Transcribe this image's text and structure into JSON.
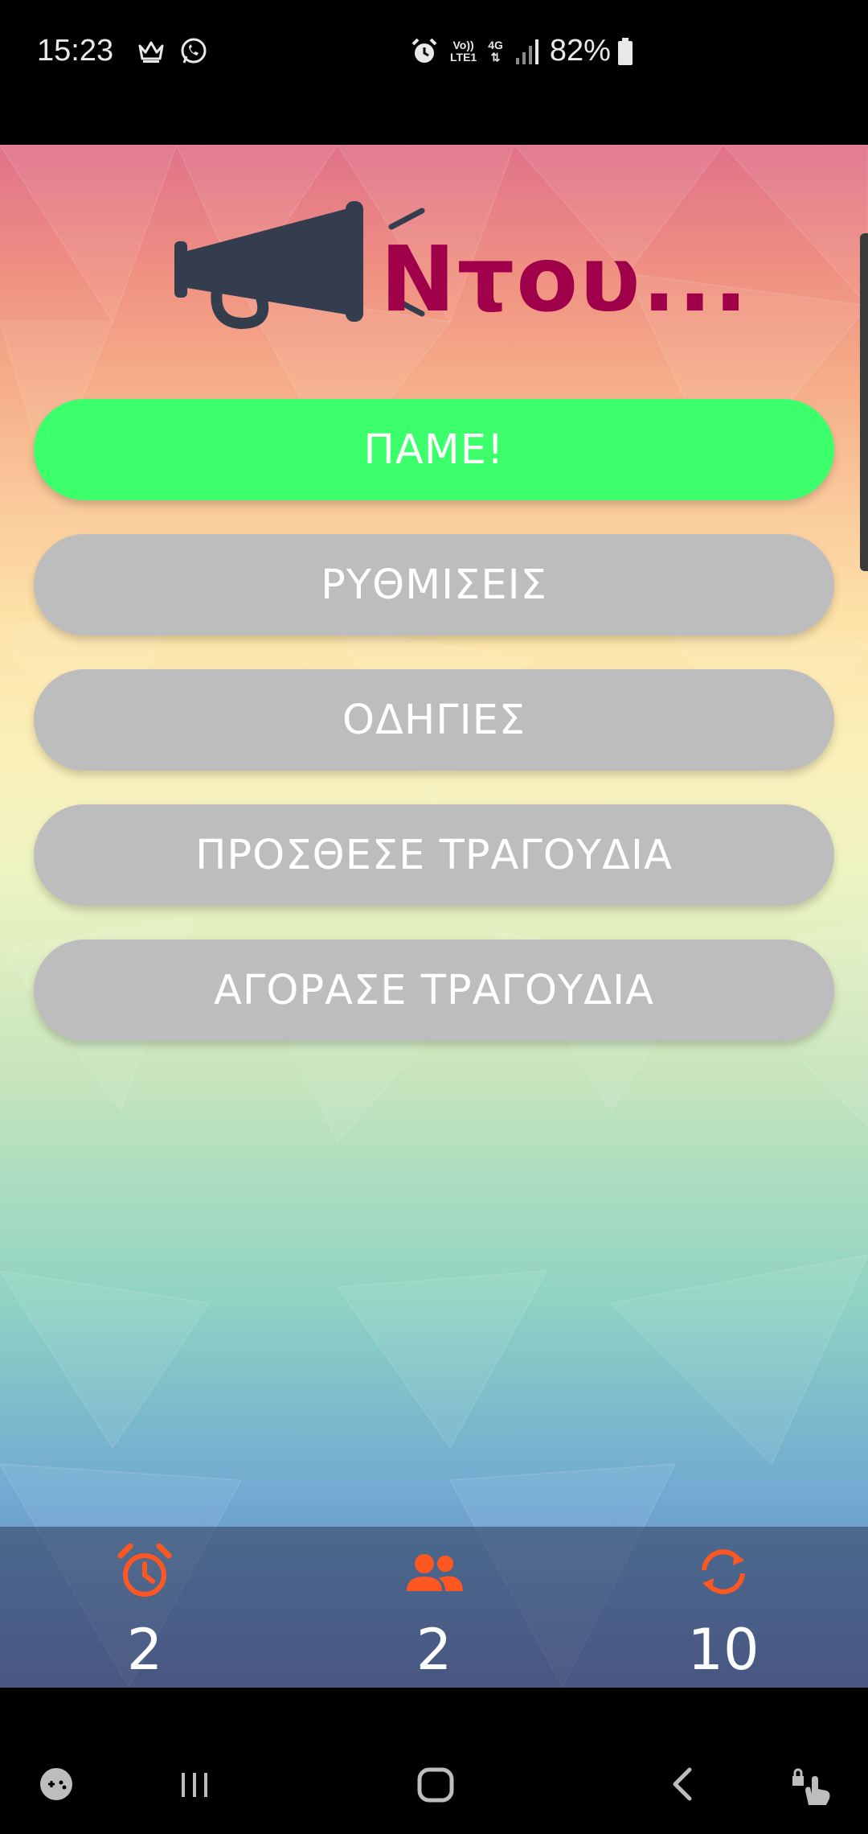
{
  "status_bar": {
    "time": "15:23",
    "network_line1": "Vo))",
    "network_line2": "LTE1",
    "network_type": "4G",
    "battery": "82%"
  },
  "app": {
    "logo_text": "Ντου...",
    "menu": {
      "play_label": "ΠΑΜΕ!",
      "settings_label": "ΡΥΘΜΙΣΕΙΣ",
      "instructions_label": "ΟΔΗΓΙΕΣ",
      "add_songs_label": "ΠΡΟΣΘΕΣΕ ΤΡΑΓΟΥΔΙΑ",
      "buy_songs_label": "ΑΓΟΡΑΣΕ ΤΡΑΓΟΥΔΙΑ"
    },
    "stats": {
      "timer": "2",
      "players": "2",
      "rounds": "10"
    }
  },
  "colors": {
    "accent_green": "#3cff6c",
    "button_gray": "#bdbdbd",
    "logo_text": "#a0004a",
    "stat_icon": "#ff5722"
  }
}
